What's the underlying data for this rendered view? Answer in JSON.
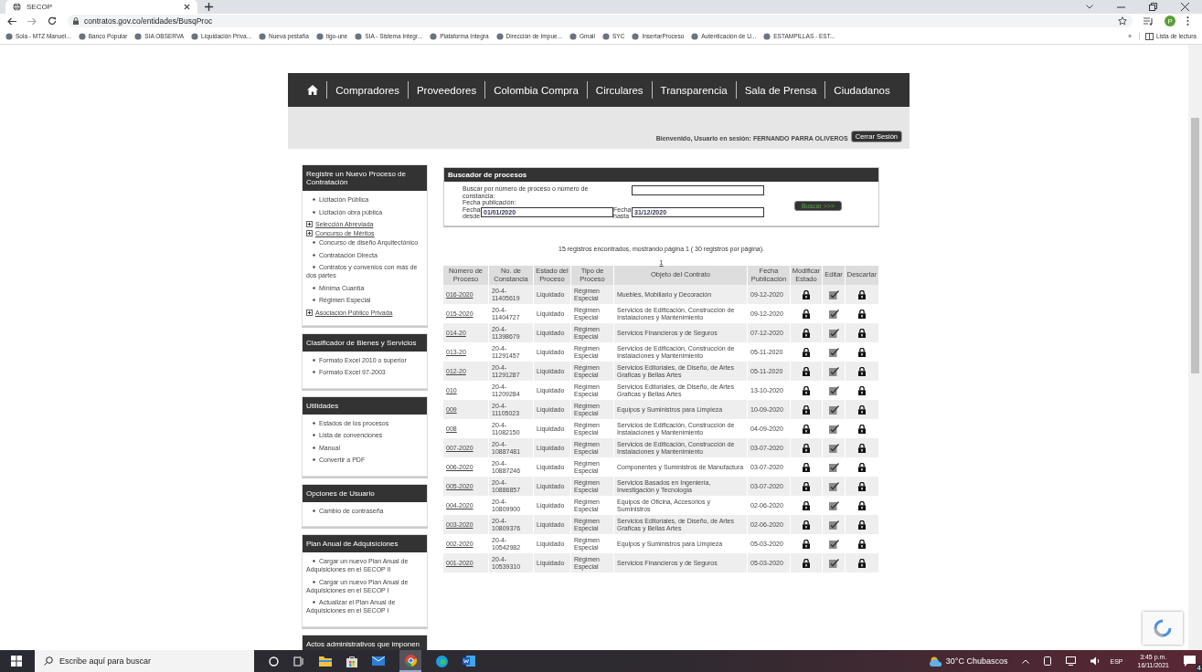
{
  "browser": {
    "tab_title": "SECOP",
    "url": "contratos.gov.co/entidades/BusqProc",
    "profile_initial": "P",
    "bookmarks": [
      "Sola - MTZ Manuel...",
      "Banco Popular",
      "SIA OBSERVA",
      "Liquidación Priva...",
      "Nueva pestaña",
      "tigo-une",
      "SIA - Sistema Integr...",
      "Plataforma Integra",
      "Dirección de Impue...",
      "Gmail",
      "SYC",
      "InsertarProceso",
      "Autenticación de U...",
      "ESTAMPILLAS - EST..."
    ],
    "bookmarks_overflow": "»",
    "reading_list": "Lista de lectura"
  },
  "nav": {
    "items": [
      "Compradores",
      "Proveedores",
      "Colombia Compra",
      "Circulares",
      "Transparencia",
      "Sala de Prensa",
      "Ciudadanos"
    ]
  },
  "session": {
    "welcome": "Bienvenido, Usuario en sesión: FERNANDO PARRA OLIVEROS",
    "logout": "Cerrar Sesión"
  },
  "sidebar": {
    "sections": [
      {
        "title": "Registre un Nuevo Proceso de Contratación",
        "items": [
          {
            "label": "Licitación Pública",
            "kind": "bullet"
          },
          {
            "label": "Licitación obra pública",
            "kind": "bullet"
          },
          {
            "label": "Selección Abreviada",
            "kind": "expand"
          },
          {
            "label": "Concurso de Méritos",
            "kind": "expand"
          },
          {
            "label": "Concurso de diseño Arquitectónico",
            "kind": "bullet"
          },
          {
            "label": "Contratación Directa",
            "kind": "bullet"
          },
          {
            "label": "Contratos y convenios con más de dos partes",
            "kind": "bullet"
          },
          {
            "label": "Mínima Cuantía",
            "kind": "bullet"
          },
          {
            "label": "Régimen Especial",
            "kind": "bullet"
          },
          {
            "label": "Asociación Público Privada",
            "kind": "expand"
          }
        ]
      },
      {
        "title": "Clasificador de Bienes y Servicios",
        "items": [
          {
            "label": "Formato Excel 2010 o superior",
            "kind": "bullet"
          },
          {
            "label": "Formato Excel 97-2003",
            "kind": "bullet"
          }
        ]
      },
      {
        "title": "Utilidades",
        "items": [
          {
            "label": "Estados de los procesos",
            "kind": "bullet"
          },
          {
            "label": "Lista de convenciones",
            "kind": "bullet"
          },
          {
            "label": "Manual",
            "kind": "bullet"
          },
          {
            "label": "Convertir a PDF",
            "kind": "bullet"
          }
        ]
      },
      {
        "title": "Opciones de Usuario",
        "items": [
          {
            "label": "Cambio de contraseña",
            "kind": "bullet"
          }
        ]
      },
      {
        "title": "Plan Anual de Adquisiciones",
        "items": [
          {
            "label": "Cargar un nuevo Plan Anual de Adquisiciones en el SECOP II",
            "kind": "bullet"
          },
          {
            "label": "Cargar un nuevo Plan Anual de Adquisiciones en el SECOP I",
            "kind": "bullet"
          },
          {
            "label": "Actualizar el Plan Anual de Adquisiciones en el SECOP I",
            "kind": "bullet"
          }
        ]
      },
      {
        "title": "Actos administrativos que imponen"
      }
    ]
  },
  "search": {
    "title": "Buscador de procesos",
    "number_label": "Buscar por número de proceso o número de constancia:",
    "date_label": "Fecha publicación:",
    "from_label": "Fecha desde",
    "from_value": "01/01/2020",
    "to_label": "Fecha hasta",
    "to_value": "31/12/2020",
    "button": "Buscar >>>"
  },
  "results": {
    "summary": "15  registros encontrados, mostrando página 1  ( 30  registros por página).",
    "pager": "1"
  },
  "table": {
    "columns": [
      "Número de Proceso",
      "No. de Constancia",
      "Estado del Proceso",
      "Tipo de Proceso",
      "Objeto del Contrato",
      "Fecha Publicación",
      "Modificar Estado",
      "Editar",
      "Descartar"
    ],
    "rows": [
      {
        "numero": "016-2020",
        "constancia": "20-4-11405619",
        "estado": "Liquidado",
        "tipo": "Régimen Especial",
        "objeto": "Muebles, Mobiliario y Decoración",
        "fecha": "09-12-2020"
      },
      {
        "numero": "015-2020",
        "constancia": "20-4-11404727",
        "estado": "Liquidado",
        "tipo": "Régimen Especial",
        "objeto": "Servicios de Edificación, Construcción de Instalaciones y Mantenimiento",
        "fecha": "09-12-2020"
      },
      {
        "numero": "014-20",
        "constancia": "20-4-11398679",
        "estado": "Liquidado",
        "tipo": "Régimen Especial",
        "objeto": "Servicios Financieros y de Seguros",
        "fecha": "07-12-2020"
      },
      {
        "numero": "013-20",
        "constancia": "20-4-11291457",
        "estado": "Liquidado",
        "tipo": "Régimen Especial",
        "objeto": "Servicios de Edificación, Construcción de Instalaciones y Mantenimiento",
        "fecha": "05-11-2020"
      },
      {
        "numero": "012-20",
        "constancia": "20-4-11291287",
        "estado": "Liquidado",
        "tipo": "Régimen Especial",
        "objeto": "Servicios Editoriales, de Diseño, de Artes Graficas y Bellas Artes",
        "fecha": "05-11-2020"
      },
      {
        "numero": "010",
        "constancia": "20-4-11209284",
        "estado": "Liquidado",
        "tipo": "Régimen Especial",
        "objeto": "Servicios Editoriales, de Diseño, de Artes Graficas y Bellas Artes",
        "fecha": "13-10-2020"
      },
      {
        "numero": "009",
        "constancia": "20-4-11105023",
        "estado": "Liquidado",
        "tipo": "Régimen Especial",
        "objeto": "Equipos y Suministros para Limpieza",
        "fecha": "10-09-2020"
      },
      {
        "numero": "008",
        "constancia": "20-4-11082150",
        "estado": "Liquidado",
        "tipo": "Régimen Especial",
        "objeto": "Servicios de Edificación, Construcción de Instalaciones y Mantenimiento",
        "fecha": "04-09-2020"
      },
      {
        "numero": "007-2020",
        "constancia": "20-4-10887481",
        "estado": "Liquidado",
        "tipo": "Régimen Especial",
        "objeto": "Servicios de Edificación, Construcción de Instalaciones y Mantenimiento",
        "fecha": "03-07-2020"
      },
      {
        "numero": "006-2020",
        "constancia": "20-4-10887246",
        "estado": "Liquidado",
        "tipo": "Régimen Especial",
        "objeto": "Componentes y Suministros de Manufactura",
        "fecha": "03-07-2020"
      },
      {
        "numero": "005-2020",
        "constancia": "20-4-10886857",
        "estado": "Liquidado",
        "tipo": "Régimen Especial",
        "objeto": "Servicios Basados en Ingeniería, Investigación y Tecnología",
        "fecha": "03-07-2020"
      },
      {
        "numero": "004-2020",
        "constancia": "20-4-10809900",
        "estado": "Liquidado",
        "tipo": "Régimen Especial",
        "objeto": "Equipos de Oficina, Accesorios y Suministros",
        "fecha": "02-06-2020"
      },
      {
        "numero": "003-2020",
        "constancia": "20-4-10809376",
        "estado": "Liquidado",
        "tipo": "Régimen Especial",
        "objeto": "Servicios Editoriales, de Diseño, de Artes Graficas y Bellas Artes",
        "fecha": "02-06-2020"
      },
      {
        "numero": "002-2020",
        "constancia": "20-4-10542982",
        "estado": "Liquidado",
        "tipo": "Régimen Especial",
        "objeto": "Equipos y Suministros para Limpieza",
        "fecha": "05-03-2020"
      },
      {
        "numero": "001-2020",
        "constancia": "20-4-10539310",
        "estado": "Liquidado",
        "tipo": "Régimen Especial",
        "objeto": "Servicios Financieros y de Seguros",
        "fecha": "05-03-2020"
      }
    ]
  },
  "taskbar": {
    "search_placeholder": "Escribe aquí para buscar",
    "weather": "30°C  Chubascos",
    "language": "ESP",
    "time": "3:45 p.m.",
    "date": "16/11/2021",
    "notifications": "4"
  }
}
